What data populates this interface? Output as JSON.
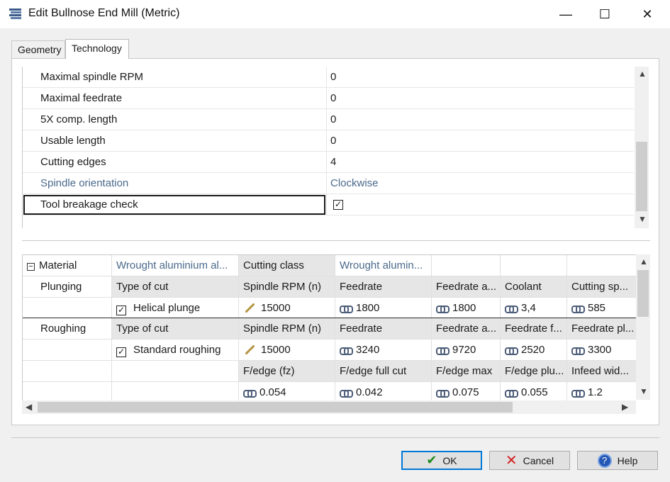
{
  "window": {
    "title": "Edit Bullnose End Mill (Metric)",
    "minimize_glyph": "—",
    "maximize_glyph": "☐",
    "close_glyph": "✕"
  },
  "tabs": [
    {
      "label": "Geometry",
      "active": false
    },
    {
      "label": "Technology",
      "active": true
    }
  ],
  "properties": [
    {
      "label": "Maximal spindle RPM",
      "value": "0"
    },
    {
      "label": "Maximal feedrate",
      "value": "0"
    },
    {
      "label": "5X comp. length",
      "value": "0"
    },
    {
      "label": "Usable length",
      "value": "0"
    },
    {
      "label": "Cutting edges",
      "value": "4"
    },
    {
      "label": "Spindle orientation",
      "value": "Clockwise"
    },
    {
      "label": "Tool breakage check",
      "checked": true
    }
  ],
  "tech": {
    "material_label": "Material",
    "material_value": "Wrought aluminium al...",
    "cutting_class_label": "Cutting class",
    "cutting_class_value": "Wrought alumin...",
    "plunging": {
      "label": "Plunging",
      "headers": [
        "Type of cut",
        "Spindle RPM (n)",
        "Feedrate",
        "Feedrate a...",
        "Coolant",
        "Cutting sp..."
      ],
      "type": "Helical plunge",
      "values": [
        "15000",
        "1800",
        "1800",
        "3,4",
        "585"
      ]
    },
    "roughing": {
      "label": "Roughing",
      "headers": [
        "Type of cut",
        "Spindle RPM (n)",
        "Feedrate",
        "Feedrate a...",
        "Feedrate f...",
        "Feedrate pl..."
      ],
      "type": "Standard roughing",
      "values": [
        "15000",
        "3240",
        "9720",
        "2520",
        "3300"
      ],
      "headers2": [
        "F/edge (fz)",
        "F/edge full cut",
        "F/edge max",
        "F/edge plu...",
        "Infeed wid..."
      ],
      "values2": [
        "0.054",
        "0.042",
        "0.075",
        "0.055",
        "1.2"
      ]
    }
  },
  "buttons": {
    "ok": "OK",
    "cancel": "Cancel",
    "help": "Help"
  },
  "colors": {
    "accent": "#0078d7",
    "muted_text": "#4a6a8c",
    "header_bg": "#e6e6e6"
  }
}
